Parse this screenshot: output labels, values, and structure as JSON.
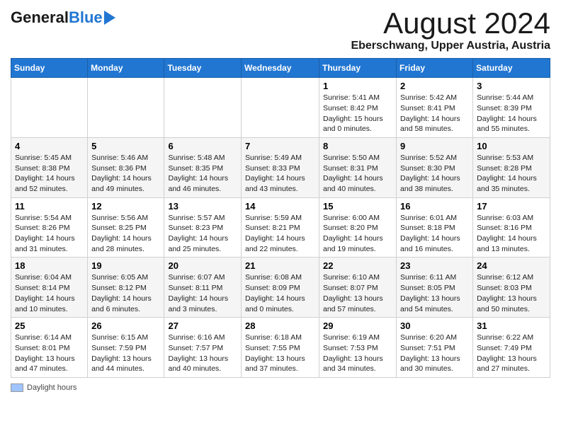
{
  "header": {
    "logo_top": "General",
    "logo_bottom": "Blue",
    "month_title": "August 2024",
    "location": "Eberschwang, Upper Austria, Austria"
  },
  "columns": [
    "Sunday",
    "Monday",
    "Tuesday",
    "Wednesday",
    "Thursday",
    "Friday",
    "Saturday"
  ],
  "legend": {
    "label": "Daylight hours"
  },
  "weeks": [
    {
      "days": [
        {
          "number": "",
          "info": ""
        },
        {
          "number": "",
          "info": ""
        },
        {
          "number": "",
          "info": ""
        },
        {
          "number": "",
          "info": ""
        },
        {
          "number": "1",
          "info": "Sunrise: 5:41 AM\nSunset: 8:42 PM\nDaylight: 15 hours\nand 0 minutes."
        },
        {
          "number": "2",
          "info": "Sunrise: 5:42 AM\nSunset: 8:41 PM\nDaylight: 14 hours\nand 58 minutes."
        },
        {
          "number": "3",
          "info": "Sunrise: 5:44 AM\nSunset: 8:39 PM\nDaylight: 14 hours\nand 55 minutes."
        }
      ]
    },
    {
      "days": [
        {
          "number": "4",
          "info": "Sunrise: 5:45 AM\nSunset: 8:38 PM\nDaylight: 14 hours\nand 52 minutes."
        },
        {
          "number": "5",
          "info": "Sunrise: 5:46 AM\nSunset: 8:36 PM\nDaylight: 14 hours\nand 49 minutes."
        },
        {
          "number": "6",
          "info": "Sunrise: 5:48 AM\nSunset: 8:35 PM\nDaylight: 14 hours\nand 46 minutes."
        },
        {
          "number": "7",
          "info": "Sunrise: 5:49 AM\nSunset: 8:33 PM\nDaylight: 14 hours\nand 43 minutes."
        },
        {
          "number": "8",
          "info": "Sunrise: 5:50 AM\nSunset: 8:31 PM\nDaylight: 14 hours\nand 40 minutes."
        },
        {
          "number": "9",
          "info": "Sunrise: 5:52 AM\nSunset: 8:30 PM\nDaylight: 14 hours\nand 38 minutes."
        },
        {
          "number": "10",
          "info": "Sunrise: 5:53 AM\nSunset: 8:28 PM\nDaylight: 14 hours\nand 35 minutes."
        }
      ]
    },
    {
      "days": [
        {
          "number": "11",
          "info": "Sunrise: 5:54 AM\nSunset: 8:26 PM\nDaylight: 14 hours\nand 31 minutes."
        },
        {
          "number": "12",
          "info": "Sunrise: 5:56 AM\nSunset: 8:25 PM\nDaylight: 14 hours\nand 28 minutes."
        },
        {
          "number": "13",
          "info": "Sunrise: 5:57 AM\nSunset: 8:23 PM\nDaylight: 14 hours\nand 25 minutes."
        },
        {
          "number": "14",
          "info": "Sunrise: 5:59 AM\nSunset: 8:21 PM\nDaylight: 14 hours\nand 22 minutes."
        },
        {
          "number": "15",
          "info": "Sunrise: 6:00 AM\nSunset: 8:20 PM\nDaylight: 14 hours\nand 19 minutes."
        },
        {
          "number": "16",
          "info": "Sunrise: 6:01 AM\nSunset: 8:18 PM\nDaylight: 14 hours\nand 16 minutes."
        },
        {
          "number": "17",
          "info": "Sunrise: 6:03 AM\nSunset: 8:16 PM\nDaylight: 14 hours\nand 13 minutes."
        }
      ]
    },
    {
      "days": [
        {
          "number": "18",
          "info": "Sunrise: 6:04 AM\nSunset: 8:14 PM\nDaylight: 14 hours\nand 10 minutes."
        },
        {
          "number": "19",
          "info": "Sunrise: 6:05 AM\nSunset: 8:12 PM\nDaylight: 14 hours\nand 6 minutes."
        },
        {
          "number": "20",
          "info": "Sunrise: 6:07 AM\nSunset: 8:11 PM\nDaylight: 14 hours\nand 3 minutes."
        },
        {
          "number": "21",
          "info": "Sunrise: 6:08 AM\nSunset: 8:09 PM\nDaylight: 14 hours\nand 0 minutes."
        },
        {
          "number": "22",
          "info": "Sunrise: 6:10 AM\nSunset: 8:07 PM\nDaylight: 13 hours\nand 57 minutes."
        },
        {
          "number": "23",
          "info": "Sunrise: 6:11 AM\nSunset: 8:05 PM\nDaylight: 13 hours\nand 54 minutes."
        },
        {
          "number": "24",
          "info": "Sunrise: 6:12 AM\nSunset: 8:03 PM\nDaylight: 13 hours\nand 50 minutes."
        }
      ]
    },
    {
      "days": [
        {
          "number": "25",
          "info": "Sunrise: 6:14 AM\nSunset: 8:01 PM\nDaylight: 13 hours\nand 47 minutes."
        },
        {
          "number": "26",
          "info": "Sunrise: 6:15 AM\nSunset: 7:59 PM\nDaylight: 13 hours\nand 44 minutes."
        },
        {
          "number": "27",
          "info": "Sunrise: 6:16 AM\nSunset: 7:57 PM\nDaylight: 13 hours\nand 40 minutes."
        },
        {
          "number": "28",
          "info": "Sunrise: 6:18 AM\nSunset: 7:55 PM\nDaylight: 13 hours\nand 37 minutes."
        },
        {
          "number": "29",
          "info": "Sunrise: 6:19 AM\nSunset: 7:53 PM\nDaylight: 13 hours\nand 34 minutes."
        },
        {
          "number": "30",
          "info": "Sunrise: 6:20 AM\nSunset: 7:51 PM\nDaylight: 13 hours\nand 30 minutes."
        },
        {
          "number": "31",
          "info": "Sunrise: 6:22 AM\nSunset: 7:49 PM\nDaylight: 13 hours\nand 27 minutes."
        }
      ]
    }
  ]
}
